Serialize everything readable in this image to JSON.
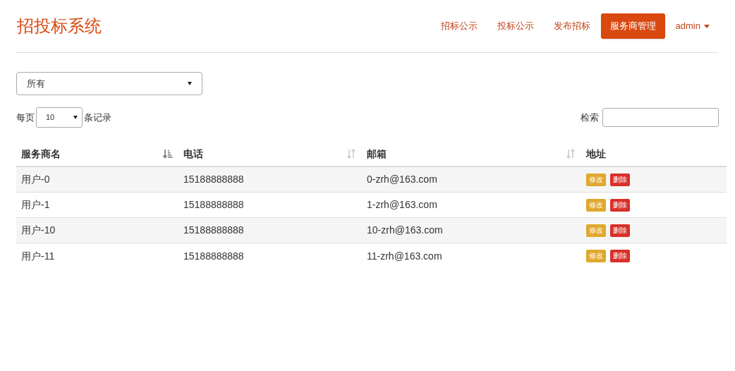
{
  "brand": "招投标系统",
  "nav": [
    {
      "label": "招标公示",
      "selected": false
    },
    {
      "label": "投标公示",
      "selected": false
    },
    {
      "label": "发布招标",
      "selected": false
    },
    {
      "label": "服务商管理",
      "selected": true
    }
  ],
  "user_menu": {
    "label": "admin"
  },
  "filter_select": {
    "value": "所有"
  },
  "page_size": {
    "prefix": "每页",
    "value": "10",
    "suffix": "条记录"
  },
  "search": {
    "label": "检索"
  },
  "table": {
    "columns": [
      {
        "label": "服务商名",
        "sortable": true,
        "sorted": true
      },
      {
        "label": "电话",
        "sortable": true,
        "sorted": false
      },
      {
        "label": "邮箱",
        "sortable": true,
        "sorted": false
      },
      {
        "label": "地址",
        "sortable": false
      }
    ],
    "rows": [
      {
        "cells": [
          "用户-0",
          "15188888888",
          "0-zrh@163.com"
        ],
        "actions": [
          "修改",
          "删除"
        ]
      },
      {
        "cells": [
          "用户-1",
          "15188888888",
          "1-zrh@163.com"
        ],
        "actions": [
          "修改",
          "删除"
        ]
      },
      {
        "cells": [
          "用户-10",
          "15188888888",
          "10-zrh@163.com"
        ],
        "actions": [
          "修改",
          "删除"
        ]
      },
      {
        "cells": [
          "用户-11",
          "15188888888",
          "11-zrh@163.com"
        ],
        "actions": [
          "修改",
          "删除"
        ]
      }
    ]
  }
}
